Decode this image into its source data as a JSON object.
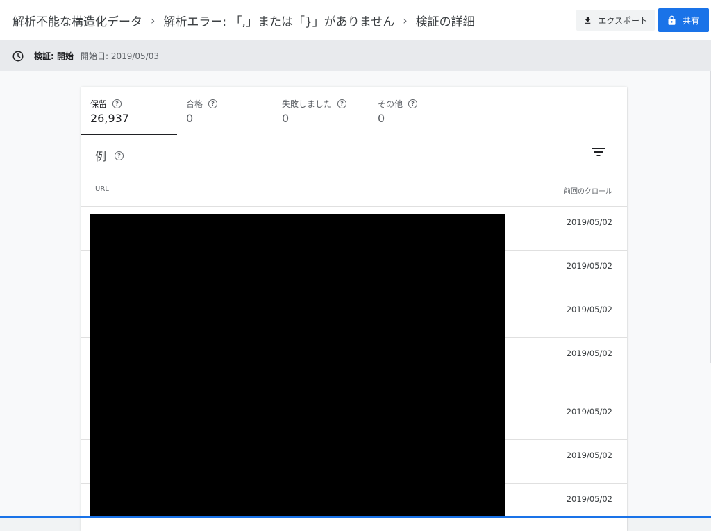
{
  "breadcrumb": {
    "items": [
      "解析不能な構造化データ",
      "解析エラー: 「,」または「}」がありません",
      "検証の詳細"
    ],
    "separator": "›"
  },
  "actions": {
    "export_label": "エクスポート",
    "share_label": "共有"
  },
  "status": {
    "label": "検証: 開始",
    "date_text": "開始日: 2019/05/03"
  },
  "tabs": [
    {
      "label": "保留",
      "value": "26,937",
      "active": true
    },
    {
      "label": "合格",
      "value": "0",
      "active": false
    },
    {
      "label": "失敗しました",
      "value": "0",
      "active": false
    },
    {
      "label": "その他",
      "value": "0",
      "active": false
    }
  ],
  "section": {
    "title": "例"
  },
  "table": {
    "columns": [
      "URL",
      "前回のクロール"
    ],
    "rows": [
      {
        "crawl_date": "2019/05/02"
      },
      {
        "crawl_date": "2019/05/02"
      },
      {
        "crawl_date": "2019/05/02"
      },
      {
        "crawl_date": "2019/05/02"
      },
      {
        "crawl_date": "2019/05/02"
      },
      {
        "crawl_date": "2019/05/02"
      },
      {
        "crawl_date": "2019/05/02"
      }
    ]
  },
  "icons": {
    "clock": "clock-icon",
    "download": "download-icon",
    "lock": "lock-icon",
    "help": "help-icon",
    "filter": "filter-icon",
    "chevron": "chevron-right-icon"
  },
  "colors": {
    "accent": "#1a73e8",
    "statusbar": "#e8eaed",
    "redaction": "#000000"
  }
}
